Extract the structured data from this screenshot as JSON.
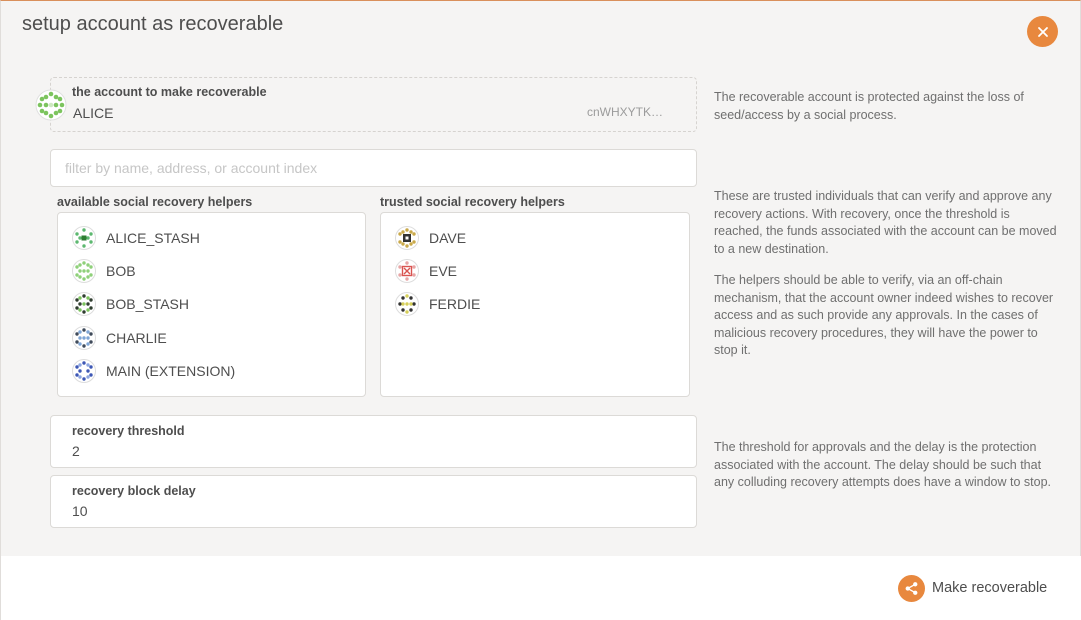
{
  "modal": {
    "title": "setup account as recoverable",
    "close_icon": "close-icon",
    "accent_color": "#e8883e"
  },
  "account": {
    "label": "the account to make recoverable",
    "name": "ALICE",
    "address": "cnWHXYTK…",
    "help": "The recoverable account is protected against the loss of seed/access by a social process."
  },
  "filter": {
    "placeholder": "filter by name, address, or account index",
    "value": ""
  },
  "available": {
    "label": "available social recovery helpers",
    "items": [
      {
        "name": "ALICE_STASH",
        "icon": "identicon"
      },
      {
        "name": "BOB",
        "icon": "identicon"
      },
      {
        "name": "BOB_STASH",
        "icon": "identicon"
      },
      {
        "name": "CHARLIE",
        "icon": "identicon"
      },
      {
        "name": "MAIN (EXTENSION)",
        "icon": "identicon"
      }
    ]
  },
  "trusted": {
    "label": "trusted social recovery helpers",
    "items": [
      {
        "name": "DAVE",
        "icon": "identicon"
      },
      {
        "name": "EVE",
        "icon": "identicon"
      },
      {
        "name": "FERDIE",
        "icon": "identicon"
      }
    ]
  },
  "helpers_help": {
    "p1": "These are trusted individuals that can verify and approve any recovery actions. With recovery, once the threshold is reached, the funds associated with the account can be moved to a new destination.",
    "p2": "The helpers should be able to verify, via an off-chain mechanism, that the account owner indeed wishes to recover access and as such provide any approvals. In the cases of malicious recovery procedures, they will have the power to stop it."
  },
  "threshold": {
    "label": "recovery threshold",
    "value": "2"
  },
  "delay": {
    "label": "recovery block delay",
    "value": "10"
  },
  "threshold_help": "The threshold for approvals and the delay is the protection associated with the account. The delay should be such that any colluding recovery attempts does have a window to stop.",
  "footer": {
    "make_label": "Make recoverable",
    "make_icon": "share-icon"
  }
}
